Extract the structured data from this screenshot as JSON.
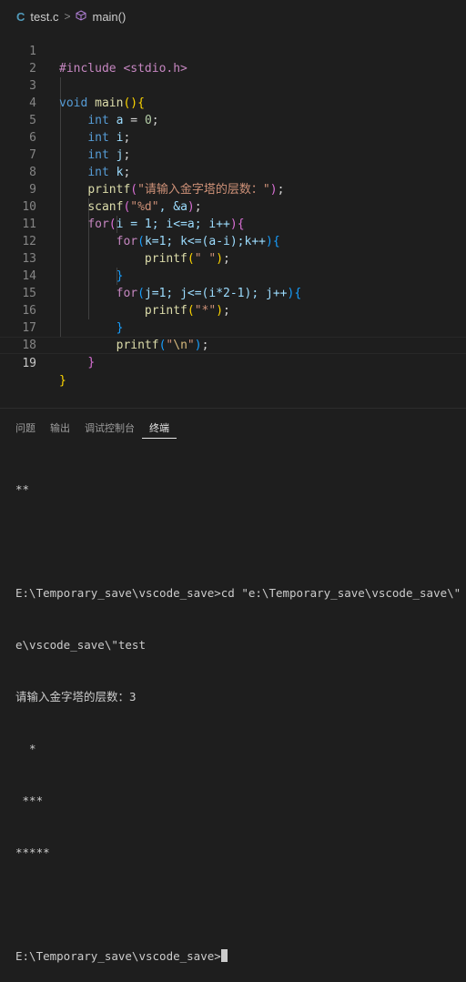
{
  "breadcrumb": {
    "file_icon": "C",
    "file": "test.c",
    "separator": ">",
    "symbol_icon": "cube-icon",
    "symbol": "main()"
  },
  "editor": {
    "current_line": 19,
    "lines": [
      {
        "n": "1"
      },
      {
        "n": "2"
      },
      {
        "n": "3"
      },
      {
        "n": "4"
      },
      {
        "n": "5"
      },
      {
        "n": "6"
      },
      {
        "n": "7"
      },
      {
        "n": "8"
      },
      {
        "n": "9"
      },
      {
        "n": "10"
      },
      {
        "n": "11"
      },
      {
        "n": "12"
      },
      {
        "n": "13"
      },
      {
        "n": "14"
      },
      {
        "n": "15"
      },
      {
        "n": "16"
      },
      {
        "n": "17"
      },
      {
        "n": "18"
      },
      {
        "n": "19"
      }
    ],
    "code": {
      "l1": "#include <stdio.h>",
      "l3_type": "void",
      "l3_fn": "main",
      "type_int": "int",
      "l4_var": "a",
      "l4_eq": " = ",
      "l4_num": "0",
      "semi": ";",
      "l5_var": "i",
      "l6_var": "j",
      "l7_var": "k",
      "printf": "printf",
      "scanf": "scanf",
      "l8_str": "\"请输入金字塔的层数：\"",
      "l9_str": "\"%d\"",
      "l9_rest": ", &a",
      "for": "for",
      "l10_inner": "i = 1; i<=a; i++",
      "l11_inner": "k=1; k<=(a-i);k++",
      "l12_str": "\" \"",
      "l14_inner": "j=1; j<=(i*2-1); j++",
      "l15_str": "\"*\"",
      "l17_str_open": "\"",
      "l17_esc": "\\n",
      "l17_str_close": "\""
    }
  },
  "panel": {
    "tabs": [
      {
        "label": "问题"
      },
      {
        "label": "输出"
      },
      {
        "label": "调试控制台"
      },
      {
        "label": "终端"
      }
    ],
    "active_tab": "终端",
    "terminal_lines": [
      "**",
      "",
      "E:\\Temporary_save\\vscode_save>cd \"e:\\Temporary_save\\vscode_save\\\" && gc",
      "e\\vscode_save\\\"test",
      "请输入金字塔的层数：3",
      "  *",
      " ***",
      "*****",
      "",
      "E:\\Temporary_save\\vscode_save>"
    ]
  },
  "colors": {
    "background": "#1e1e1e",
    "keyword": "#569cd6",
    "function": "#dcdcaa",
    "string": "#ce9178",
    "variable": "#9cdcfe",
    "control": "#c586c0"
  }
}
